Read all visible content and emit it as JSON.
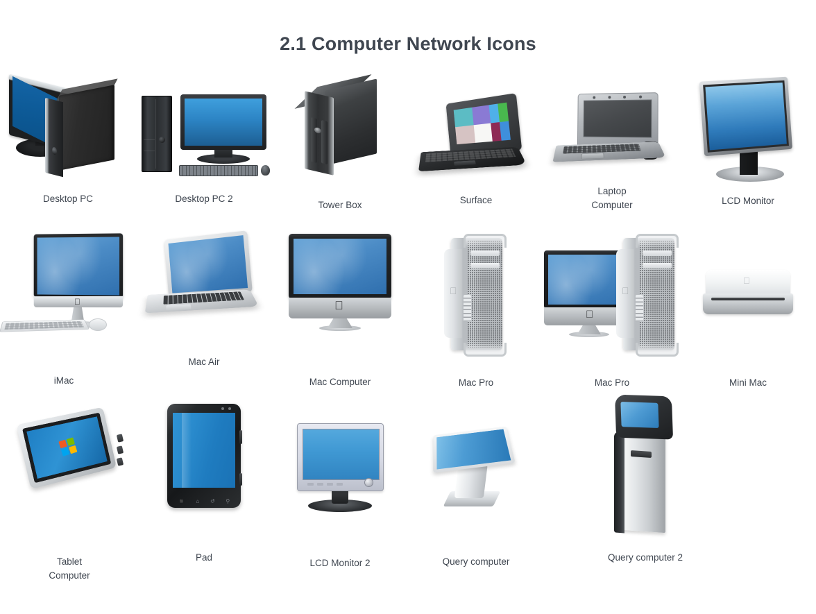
{
  "page": {
    "title": "2.1 Computer Network Icons",
    "background_color": "#ffffff",
    "title_color": "#3f4650",
    "label_color": "#3f4650"
  },
  "rows": [
    {
      "items": [
        {
          "label": "Desktop PC",
          "icon": "desktop-pc-icon"
        },
        {
          "label": "Desktop PC 2",
          "icon": "desktop-pc-2-icon"
        },
        {
          "label": "Tower Box",
          "icon": "tower-box-icon"
        },
        {
          "label": "Surface",
          "icon": "surface-icon"
        },
        {
          "label": "Laptop\nComputer",
          "icon": "laptop-computer-icon"
        },
        {
          "label": "LCD Monitor",
          "icon": "lcd-monitor-icon"
        }
      ]
    },
    {
      "items": [
        {
          "label": "iMac",
          "icon": "imac-icon"
        },
        {
          "label": "Mac Air",
          "icon": "mac-air-icon"
        },
        {
          "label": "Mac Computer",
          "icon": "mac-computer-icon"
        },
        {
          "label": "Mac Pro",
          "icon": "mac-pro-icon"
        },
        {
          "label": "Mac Pro",
          "icon": "mac-pro-2-icon"
        },
        {
          "label": "Mini Mac",
          "icon": "mini-mac-icon"
        }
      ]
    },
    {
      "items": [
        {
          "label": "Tablet\nComputer",
          "icon": "tablet-computer-icon"
        },
        {
          "label": "Pad",
          "icon": "pad-icon"
        },
        {
          "label": "LCD Monitor 2",
          "icon": "lcd-monitor-2-icon"
        },
        {
          "label": "Query computer",
          "icon": "query-computer-icon"
        },
        {
          "label": "Query computer 2",
          "icon": "query-computer-2-icon"
        }
      ]
    }
  ],
  "surface_tiles": [
    "#5cbcc4",
    "#8a7ad4",
    "#4fb0e8",
    "#4fb0e8",
    "#d6c3c3",
    "#f7f7f5",
    "#8e2a55",
    "#3f8fdc"
  ],
  "surface_tile_extra": [
    "#49b84e"
  ],
  "windows_logo_colors": [
    "#f05a22",
    "#7cbb00",
    "#00a4ef",
    "#ffb900"
  ],
  "pad_soft_buttons": [
    "⊞",
    "⌂",
    "↺",
    "⚲"
  ]
}
